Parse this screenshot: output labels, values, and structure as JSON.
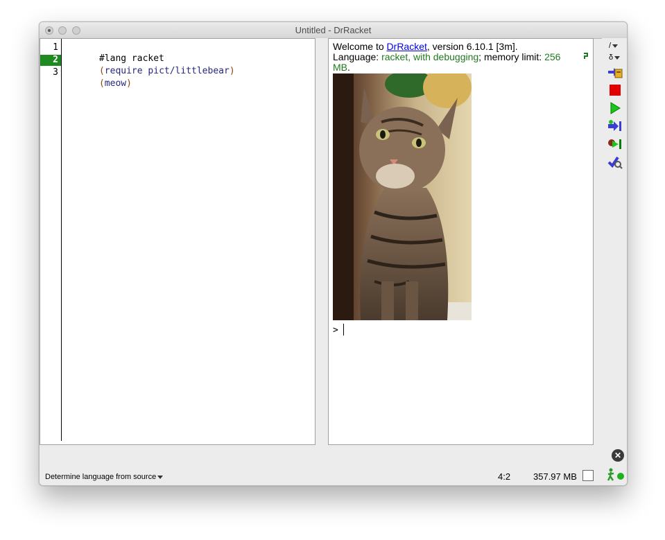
{
  "window": {
    "title": "Untitled - DrRacket"
  },
  "editor": {
    "lines": [
      {
        "number": "1",
        "text": "#lang racket"
      },
      {
        "number": "2",
        "open": "(",
        "text": "require pict/littlebear",
        "close": ")"
      },
      {
        "number": "3",
        "open": "(",
        "text": "meow",
        "close": ")"
      }
    ],
    "active_line": "2"
  },
  "interactions": {
    "welcome_prefix": "Welcome to ",
    "welcome_link": "DrRacket",
    "welcome_suffix": ", version 6.10.1 [3m].",
    "language_prefix": "Language: ",
    "language_value": "racket, with debugging",
    "memory_prefix": "; memory limit: ",
    "memory_value": "256",
    "memory_unit": "MB",
    "memory_end": ".",
    "prompt": ">"
  },
  "toolbar": {
    "function_menu": "/",
    "delta_menu": "δ",
    "buttons": [
      "check-syntax",
      "stop",
      "run",
      "step",
      "debug",
      "macro-stepper"
    ]
  },
  "status": {
    "language_select": "Determine language from source",
    "position": "4:2",
    "memory": "357.97 MB"
  },
  "colors": {
    "active_line": "#1f8a1f",
    "language_green": "#1f7a1f",
    "link_blue": "#0000ee",
    "stop_red": "#e00000",
    "run_green": "#19c619"
  }
}
